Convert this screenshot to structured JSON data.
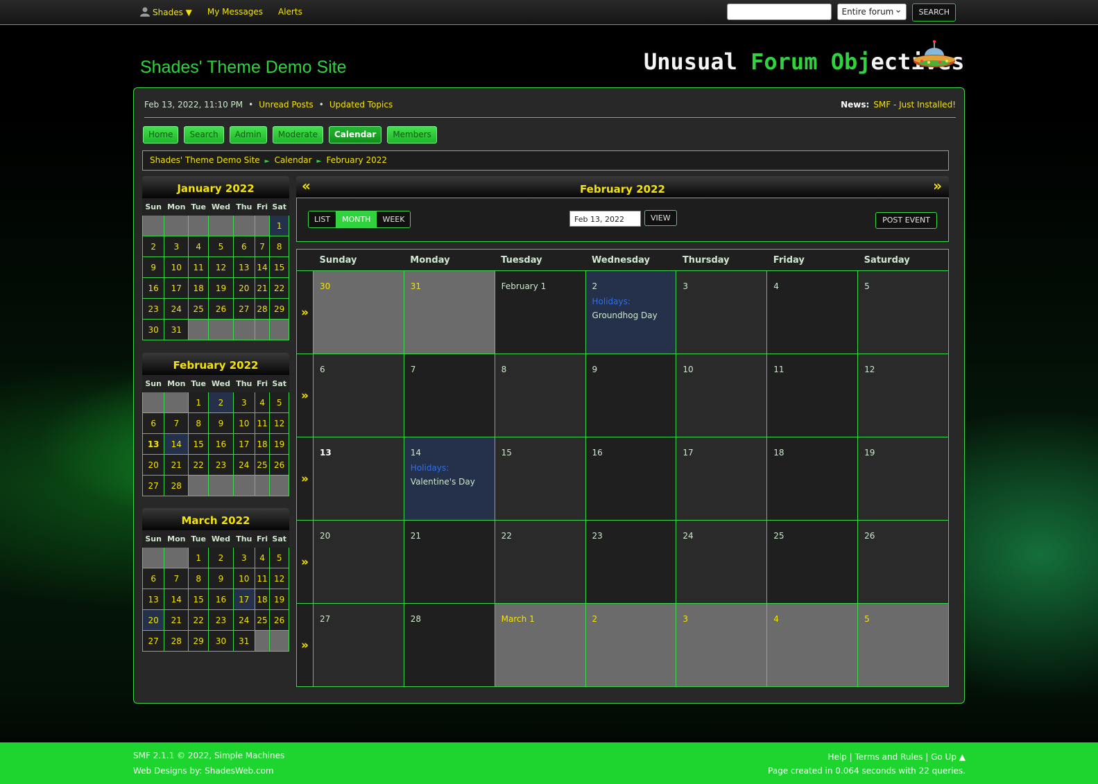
{
  "topbar": {
    "user": "Shades",
    "my_messages": "My Messages",
    "alerts": "Alerts",
    "search_placeholder": "",
    "search_scope": "Entire forum",
    "search_button": "SEARCH"
  },
  "header": {
    "site_title": "Shades' Theme Demo Site",
    "logo_part1": "Unusual ",
    "logo_part2": "Forum ",
    "logo_part3": "Obj",
    "logo_part4": "ectives"
  },
  "infobar": {
    "datetime": "Feb 13, 2022, 11:10 PM",
    "unread": "Unread Posts",
    "updated": "Updated Topics",
    "news_label": "News:",
    "news_text": "SMF - Just Installed!"
  },
  "nav": [
    "Home",
    "Search",
    "Admin",
    "Moderate",
    "Calendar",
    "Members"
  ],
  "breadcrumb": [
    "Shades' Theme Demo Site",
    "Calendar",
    "February 2022"
  ],
  "mini_days": [
    "Sun",
    "Mon",
    "Tue",
    "Wed",
    "Thu",
    "Fri",
    "Sat"
  ],
  "minis": [
    {
      "title": "January 2022",
      "weeks": [
        [
          "",
          "",
          "",
          "",
          "",
          "",
          "1"
        ],
        [
          "2",
          "3",
          "4",
          "5",
          "6",
          "7",
          "8"
        ],
        [
          "9",
          "10",
          "11",
          "12",
          "13",
          "14",
          "15"
        ],
        [
          "16",
          "17",
          "18",
          "19",
          "20",
          "21",
          "22"
        ],
        [
          "23",
          "24",
          "25",
          "26",
          "27",
          "28",
          "29"
        ],
        [
          "30",
          "31",
          "",
          "",
          "",
          "",
          ""
        ]
      ]
    },
    {
      "title": "February 2022",
      "weeks": [
        [
          "",
          "",
          "1",
          "2",
          "3",
          "4",
          "5"
        ],
        [
          "6",
          "7",
          "8",
          "9",
          "10",
          "11",
          "12"
        ],
        [
          "13",
          "14",
          "15",
          "16",
          "17",
          "18",
          "19"
        ],
        [
          "20",
          "21",
          "22",
          "23",
          "24",
          "25",
          "26"
        ],
        [
          "27",
          "28",
          "",
          "",
          "",
          "",
          ""
        ]
      ]
    },
    {
      "title": "March 2022",
      "weeks": [
        [
          "",
          "",
          "1",
          "2",
          "3",
          "4",
          "5"
        ],
        [
          "6",
          "7",
          "8",
          "9",
          "10",
          "11",
          "12"
        ],
        [
          "13",
          "14",
          "15",
          "16",
          "17",
          "18",
          "19"
        ],
        [
          "20",
          "21",
          "22",
          "23",
          "24",
          "25",
          "26"
        ],
        [
          "27",
          "28",
          "29",
          "30",
          "31",
          "",
          ""
        ]
      ]
    }
  ],
  "calendar": {
    "title": "February 2022",
    "prev": "«",
    "next": "»",
    "week_arrow": "»",
    "views": [
      "LIST",
      "MONTH",
      "WEEK"
    ],
    "date_value": "Feb 13, 2022",
    "view_button": "VIEW",
    "post_event": "POST EVENT",
    "days": [
      "Sunday",
      "Monday",
      "Tuesday",
      "Wednesday",
      "Thursday",
      "Friday",
      "Saturday"
    ],
    "weeks": [
      [
        {
          "d": "30",
          "t": "out"
        },
        {
          "d": "31",
          "t": "out"
        },
        {
          "d": "February 1",
          "t": "dk"
        },
        {
          "d": "2",
          "t": "hl",
          "ev_cat": "Holidays:",
          "ev_name": "Groundhog Day"
        },
        {
          "d": "3",
          "t": "lt"
        },
        {
          "d": "4",
          "t": "dk"
        },
        {
          "d": "5",
          "t": "lt"
        }
      ],
      [
        {
          "d": "6",
          "t": "lt"
        },
        {
          "d": "7",
          "t": "dk"
        },
        {
          "d": "8",
          "t": "lt"
        },
        {
          "d": "9",
          "t": "dk"
        },
        {
          "d": "10",
          "t": "lt"
        },
        {
          "d": "11",
          "t": "dk"
        },
        {
          "d": "12",
          "t": "lt"
        }
      ],
      [
        {
          "d": "13",
          "t": "lt today"
        },
        {
          "d": "14",
          "t": "hl",
          "ev_cat": "Holidays:",
          "ev_name": "Valentine's Day"
        },
        {
          "d": "15",
          "t": "lt"
        },
        {
          "d": "16",
          "t": "dk"
        },
        {
          "d": "17",
          "t": "lt"
        },
        {
          "d": "18",
          "t": "dk"
        },
        {
          "d": "19",
          "t": "lt"
        }
      ],
      [
        {
          "d": "20",
          "t": "lt"
        },
        {
          "d": "21",
          "t": "dk"
        },
        {
          "d": "22",
          "t": "lt"
        },
        {
          "d": "23",
          "t": "dk"
        },
        {
          "d": "24",
          "t": "lt"
        },
        {
          "d": "25",
          "t": "dk"
        },
        {
          "d": "26",
          "t": "lt"
        }
      ],
      [
        {
          "d": "27",
          "t": "lt"
        },
        {
          "d": "28",
          "t": "dk"
        },
        {
          "d": "March 1",
          "t": "out"
        },
        {
          "d": "2",
          "t": "out"
        },
        {
          "d": "3",
          "t": "out"
        },
        {
          "d": "4",
          "t": "out"
        },
        {
          "d": "5",
          "t": "out"
        }
      ]
    ]
  },
  "footer": {
    "copyright": "SMF 2.1.1 © 2022, Simple Machines",
    "designs": "Web Designs by: ShadesWeb.com",
    "links": "Help | Terms and Rules | Go Up ▲",
    "stats": "Page created in 0.064 seconds with 22 queries."
  }
}
